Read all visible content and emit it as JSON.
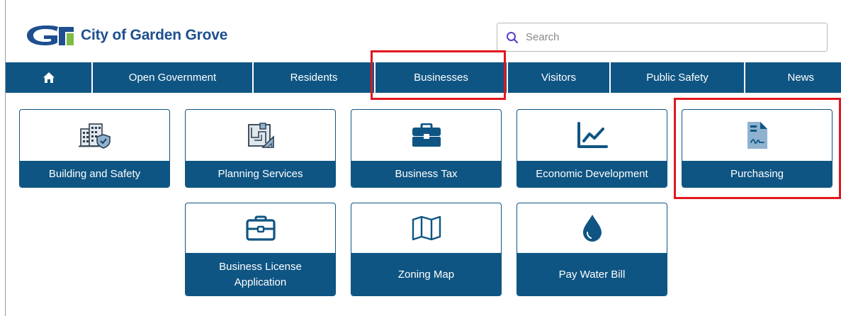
{
  "header": {
    "logo_text": "City of Garden Grove",
    "search_placeholder": "Search"
  },
  "nav": {
    "items": [
      {
        "label": "",
        "icon": "home-icon"
      },
      {
        "label": "Open Government"
      },
      {
        "label": "Residents"
      },
      {
        "label": "Businesses"
      },
      {
        "label": "Visitors"
      },
      {
        "label": "Public Safety"
      },
      {
        "label": "News"
      }
    ]
  },
  "tiles": [
    {
      "label": "Building and Safety",
      "icon": "building-shield-icon"
    },
    {
      "label": "Planning Services",
      "icon": "blueprint-icon"
    },
    {
      "label": "Business Tax",
      "icon": "briefcase-icon"
    },
    {
      "label": "Economic Development",
      "icon": "line-chart-icon"
    },
    {
      "label": "Purchasing",
      "icon": "signed-document-icon"
    },
    {
      "label": "Business License Application",
      "icon": "briefcase-outline-icon"
    },
    {
      "label": "Zoning Map",
      "icon": "map-icon"
    },
    {
      "label": "Pay Water Bill",
      "icon": "water-drop-icon"
    }
  ],
  "colors": {
    "brand": "#0f5583",
    "logo_blue": "#1f4f8f",
    "highlight": "#e0181e"
  }
}
